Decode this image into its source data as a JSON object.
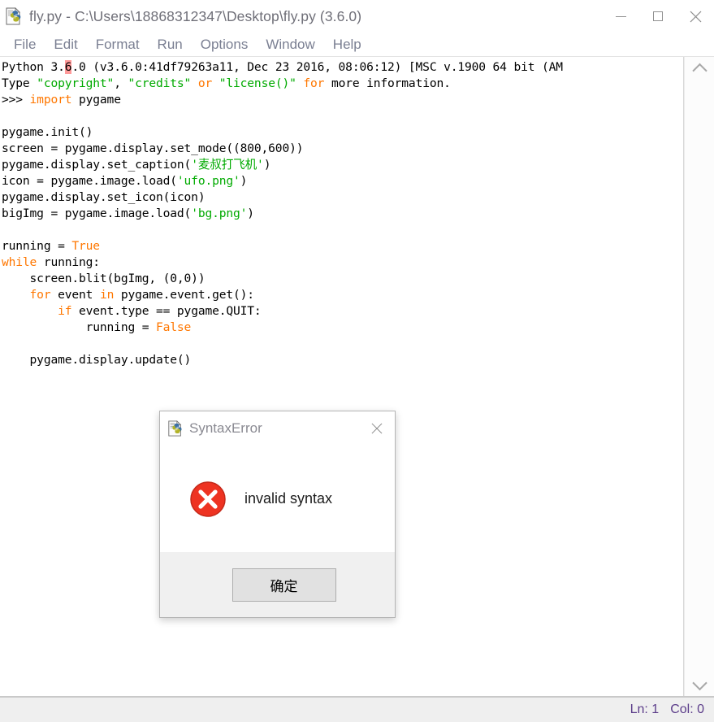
{
  "window": {
    "title": "fly.py - C:\\Users\\18868312347\\Desktop\\fly.py (3.6.0)",
    "icon": "python-file-icon",
    "controls": {
      "minimize": "minimize-button",
      "maximize": "maximize-button",
      "close": "close-button",
      "close_glyph": "✕"
    }
  },
  "menubar": {
    "items": [
      {
        "label": "File"
      },
      {
        "label": "Edit"
      },
      {
        "label": "Format"
      },
      {
        "label": "Run"
      },
      {
        "label": "Options"
      },
      {
        "label": "Window"
      },
      {
        "label": "Help"
      }
    ]
  },
  "shell": {
    "lines": [
      [
        {
          "t": "Python 3.",
          "c": "plain"
        },
        {
          "t": "6",
          "c": "hl"
        },
        {
          "t": ".0 (v3.6.0:41df79263a11, Dec 23 2016, 08:06:12) [MSC v.1900 64 bit (AM",
          "c": "plain"
        }
      ],
      [
        {
          "t": "Type ",
          "c": "plain"
        },
        {
          "t": "\"copyright\"",
          "c": "str"
        },
        {
          "t": ", ",
          "c": "plain"
        },
        {
          "t": "\"credits\"",
          "c": "str"
        },
        {
          "t": " or ",
          "c": "kw"
        },
        {
          "t": "\"license()\"",
          "c": "str"
        },
        {
          "t": " for ",
          "c": "kw"
        },
        {
          "t": "more information.",
          "c": "plain"
        }
      ],
      [
        {
          "t": ">>> ",
          "c": "plain"
        },
        {
          "t": "import",
          "c": "kw"
        },
        {
          "t": " pygame",
          "c": "plain"
        }
      ],
      [
        {
          "t": "",
          "c": "plain"
        }
      ],
      [
        {
          "t": "pygame.init()",
          "c": "plain"
        }
      ],
      [
        {
          "t": "screen = pygame.display.set_mode((800,600))",
          "c": "plain"
        }
      ],
      [
        {
          "t": "pygame.display.set_caption(",
          "c": "plain"
        },
        {
          "t": "'麦叔打飞机'",
          "c": "str"
        },
        {
          "t": ")",
          "c": "plain"
        }
      ],
      [
        {
          "t": "icon = pygame.image.load(",
          "c": "plain"
        },
        {
          "t": "'ufo.png'",
          "c": "str"
        },
        {
          "t": ")",
          "c": "plain"
        }
      ],
      [
        {
          "t": "pygame.display.set_icon(icon)",
          "c": "plain"
        }
      ],
      [
        {
          "t": "bigImg = pygame.image.load(",
          "c": "plain"
        },
        {
          "t": "'bg.png'",
          "c": "str"
        },
        {
          "t": ")",
          "c": "plain"
        }
      ],
      [
        {
          "t": "",
          "c": "plain"
        }
      ],
      [
        {
          "t": "running = ",
          "c": "plain"
        },
        {
          "t": "True",
          "c": "kw"
        }
      ],
      [
        {
          "t": "while",
          "c": "kw"
        },
        {
          "t": " running:",
          "c": "plain"
        }
      ],
      [
        {
          "t": "    screen.blit(bgImg, (0,0))",
          "c": "plain"
        }
      ],
      [
        {
          "t": "    ",
          "c": "plain"
        },
        {
          "t": "for",
          "c": "kw"
        },
        {
          "t": " event ",
          "c": "plain"
        },
        {
          "t": "in",
          "c": "kw"
        },
        {
          "t": " pygame.event.get():",
          "c": "plain"
        }
      ],
      [
        {
          "t": "        ",
          "c": "plain"
        },
        {
          "t": "if",
          "c": "kw"
        },
        {
          "t": " event.type == pygame.QUIT:",
          "c": "plain"
        }
      ],
      [
        {
          "t": "            running = ",
          "c": "plain"
        },
        {
          "t": "False",
          "c": "kw"
        }
      ],
      [
        {
          "t": "",
          "c": "plain"
        }
      ],
      [
        {
          "t": "    pygame.display.update()",
          "c": "plain"
        }
      ]
    ]
  },
  "scrollbar": {
    "up_arrow": "scroll-up-arrow",
    "down_arrow": "scroll-down-arrow"
  },
  "statusbar": {
    "line_label": "Ln: 1",
    "col_label": "Col: 0"
  },
  "dialog": {
    "title": "SyntaxError",
    "icon": "python-file-icon",
    "close_glyph": "✕",
    "message": "invalid syntax",
    "error_icon": "error-cross-icon",
    "ok_label": "确定"
  },
  "colors": {
    "string": "#00aa00",
    "keyword": "#ff7700",
    "highlight": "#ff9a9a",
    "status_text": "#5c3d8a",
    "error_red": "#ee3322"
  }
}
